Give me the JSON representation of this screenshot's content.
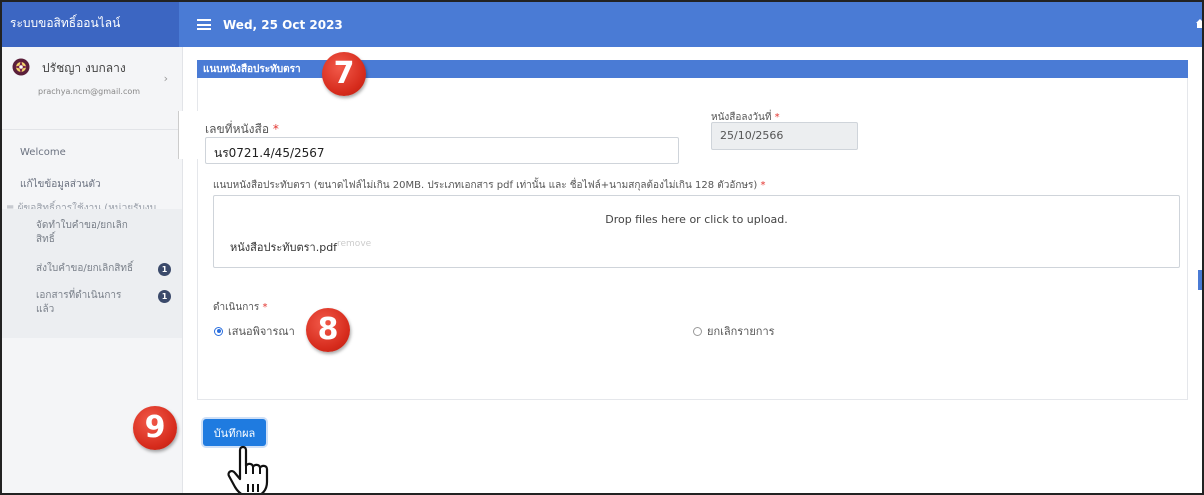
{
  "app": {
    "brand": "ระบบขอสิทธิ์ออนไลน์",
    "date": "Wed, 25 Oct 2023"
  },
  "user": {
    "name": "ปรัชญา งบกลาง",
    "email": "prachya.ncm@gmail.com"
  },
  "sidebar": {
    "welcome": "Welcome",
    "edit_profile": "แก้ไขข้อมูลส่วนตัว",
    "group_label": "ผู้ขอสิทธิ์การใช้งาน (หน่วยรับงบประมาณ)",
    "items": [
      {
        "label": "จัดทำใบคำขอ/ยกเลิกสิทธิ์",
        "badge": ""
      },
      {
        "label": "ส่งใบคำขอ/ยกเลิกสิทธิ์",
        "badge": "1"
      },
      {
        "label": "เอกสารที่ดำเนินการแล้ว",
        "badge": "1"
      }
    ]
  },
  "form": {
    "section_title": "แนบหนังสือประทับตรา",
    "doc_no_label": "เลขที่หนังสือ",
    "doc_no_value": "นร0721.4/45/2567",
    "date_label": "หนังสือลงวันที่",
    "date_value": "25/10/2566",
    "required_mark": "*",
    "attach_label": "แนบหนังสือประทับตรา (ขนาดไฟล์ไม่เกิน 20MB. ประเภทเอกสาร pdf เท่านั้น และ ชื่อไฟล์+นามสกุลต้องไม่เกิน 128 ตัวอักษร)",
    "dropzone_message": "Drop files here or click to upload.",
    "file_name": "หนังสือประทับตรา.pdf",
    "remove_label": "remove",
    "action_label": "ดำเนินการ",
    "option_submit": "เสนอพิจารณา",
    "option_cancel": "ยกเลิกรายการ",
    "save_button": "บันทึกผล"
  },
  "markers": {
    "step7": "7",
    "step8": "8",
    "step9": "9"
  },
  "colors": {
    "navbar": "#4a7bd5",
    "brand": "#3c66c2",
    "button": "#1f7be0",
    "marker": "#d62b1c",
    "badge": "#3b4a6b"
  }
}
